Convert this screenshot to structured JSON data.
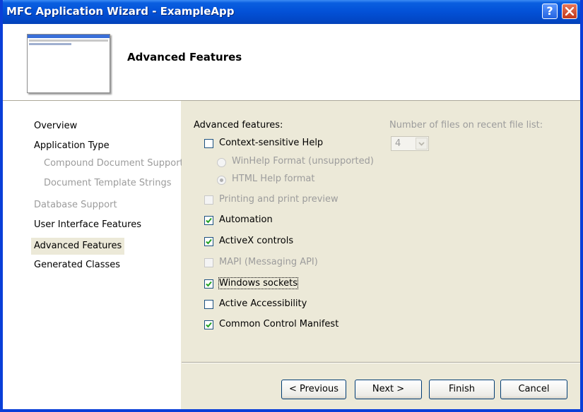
{
  "window": {
    "title": "MFC Application Wizard - ExampleApp",
    "help_label": "?",
    "accent_color": "#0a5fe0"
  },
  "header": {
    "heading": "Advanced Features"
  },
  "sidebar": {
    "items": [
      {
        "label": "Overview",
        "state": "normal"
      },
      {
        "label": "Application Type",
        "state": "normal"
      },
      {
        "label": "Compound Document Support",
        "state": "disabled"
      },
      {
        "label": "Document Template Strings",
        "state": "disabled"
      },
      {
        "label": "Database Support",
        "state": "disabled"
      },
      {
        "label": "User Interface Features",
        "state": "normal"
      },
      {
        "label": "Advanced Features",
        "state": "selected"
      },
      {
        "label": "Generated Classes",
        "state": "normal"
      }
    ]
  },
  "main": {
    "section_label": "Advanced features:",
    "options": [
      {
        "label": "Context-sensitive Help",
        "checked": false,
        "enabled": true
      },
      {
        "label": "Printing and print preview",
        "checked": false,
        "enabled": false
      },
      {
        "label": "Automation",
        "checked": true,
        "enabled": true
      },
      {
        "label": "ActiveX controls",
        "checked": true,
        "enabled": true
      },
      {
        "label": "MAPI (Messaging API)",
        "checked": false,
        "enabled": false
      },
      {
        "label": "Windows sockets",
        "checked": true,
        "enabled": true
      },
      {
        "label": "Active Accessibility",
        "checked": false,
        "enabled": true
      },
      {
        "label": "Common Control Manifest",
        "checked": true,
        "enabled": true
      }
    ],
    "help_formats": [
      {
        "label": "WinHelp Format (unsupported)",
        "selected": false
      },
      {
        "label": "HTML Help format",
        "selected": true
      }
    ],
    "recent_files_label": "Number of files on recent file list:",
    "recent_files_value": "4"
  },
  "buttons": {
    "previous": "< Previous",
    "next": "Next >",
    "finish": "Finish",
    "cancel": "Cancel"
  }
}
